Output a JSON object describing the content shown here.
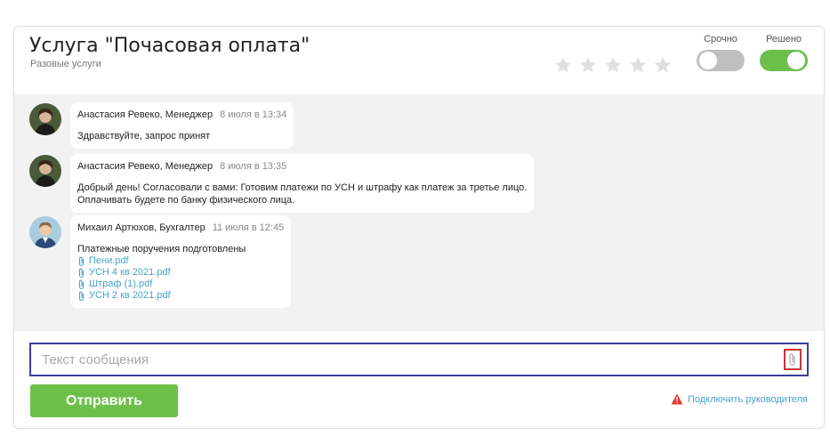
{
  "header": {
    "title": "Услуга \"Почасовая оплата\"",
    "subtitle": "Разовые услуги",
    "rating": 0,
    "urgent_label": "Срочно",
    "urgent_on": false,
    "resolved_label": "Решено",
    "resolved_on": true
  },
  "messages": [
    {
      "author": "Анастасия Ревеко, Менеджер",
      "date": "8 июля в 13:34",
      "lines": [
        "Здравствуйте, запрос принят"
      ],
      "attachments": []
    },
    {
      "author": "Анастасия Ревеко, Менеджер",
      "date": "8 июля в 13:35",
      "lines": [
        "Добрый день! Согласовали с вами: Готовим платежи по УСН и штрафу как платеж за третье лицо.",
        "Оплачивать будете по банку физического лица."
      ],
      "attachments": []
    },
    {
      "author": "Михаил Артюхов, Бухгалтер",
      "date": "11 июля в 12:45",
      "lines": [
        "Платежные поручения подготовлены"
      ],
      "attachments": [
        "Пени.pdf",
        "УСН 4 кв 2021.pdf",
        "Штраф (1).pdf",
        "УСН 2 кв 2021.pdf"
      ]
    }
  ],
  "composer": {
    "placeholder": "Текст сообщения",
    "value": "",
    "send_label": "Отправить",
    "manager_link": "Подключить руководителя"
  },
  "colors": {
    "accent_green": "#6cc04a",
    "link_blue": "#4aa3c8",
    "warning_red": "#e53935"
  }
}
